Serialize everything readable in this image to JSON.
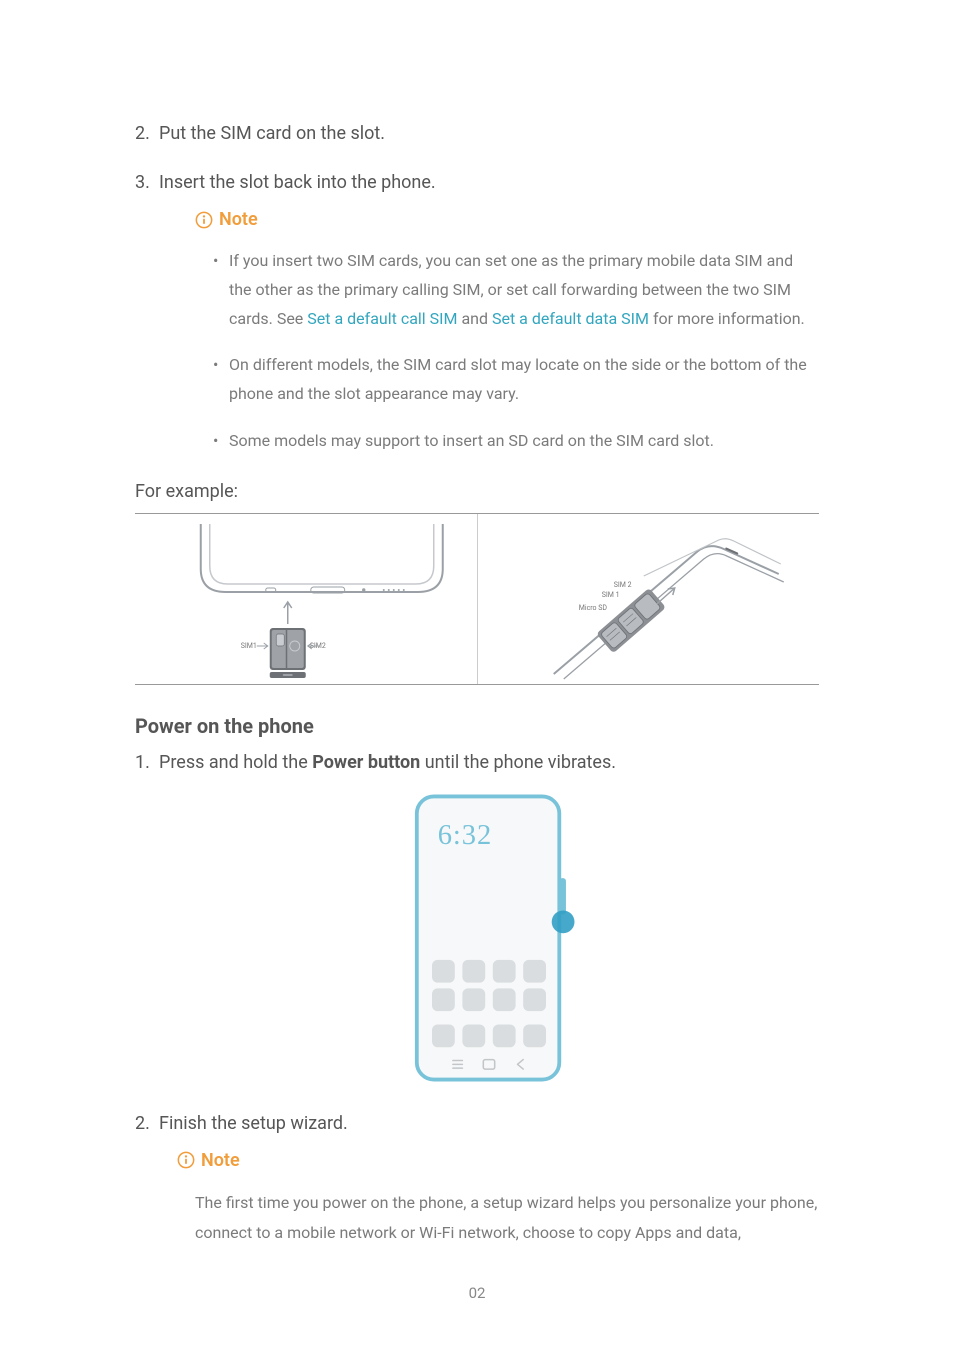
{
  "list": {
    "item2": "Put the SIM card on the slot.",
    "item3": "Insert the slot back into the phone."
  },
  "note1": {
    "title": "Note",
    "bullets": {
      "b1_pre": "If you insert two SIM cards, you can set one as the primary mobile data SIM and the other as the primary calling SIM, or set call forwarding between the two SIM cards. See ",
      "b1_link1": "Set a default call SIM",
      "b1_mid": " and ",
      "b1_link2": "Set a default data SIM",
      "b1_post": " for more information.",
      "b2": "On different models, the SIM card slot may locate on the side or the bottom of the phone and the slot appearance may vary.",
      "b3": "Some models may support to insert an SD card on the SIM card slot."
    }
  },
  "for_example": "For example:",
  "fig1": {
    "sim1": "SIM1",
    "sim2": "SIM2"
  },
  "fig2": {
    "sim1": "SIM 1",
    "sim2": "SIM 2",
    "microsd": "Micro SD"
  },
  "section": "Power on the phone",
  "power": {
    "step1_pre": "Press and hold the ",
    "step1_bold": "Power button",
    "step1_post": " until the phone vibrates.",
    "step2": "Finish the setup wizard."
  },
  "phone": {
    "clock": "6:32"
  },
  "note2": {
    "title": "Note",
    "body": "The first time you power on the phone, a setup wizard helps you personalize your phone, connect to a mobile network or Wi-Fi network, choose to copy Apps and data,"
  },
  "page_number": "02"
}
